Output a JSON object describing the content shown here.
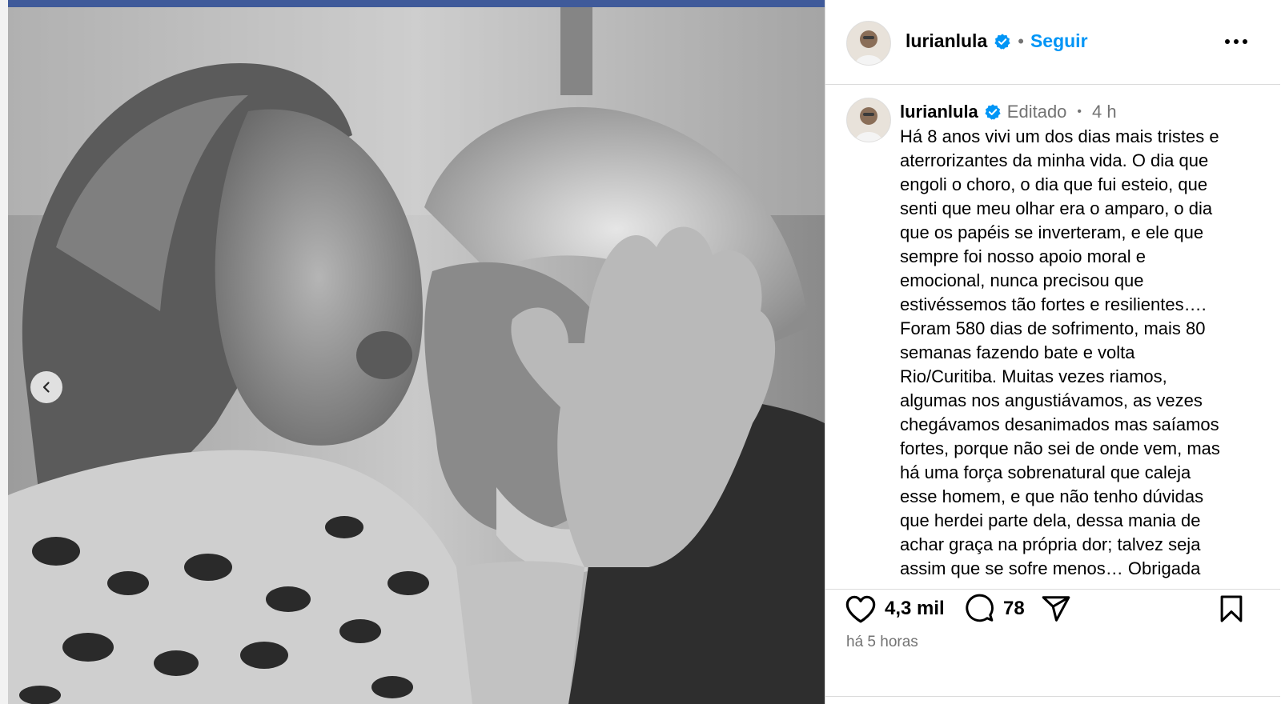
{
  "post": {
    "username": "lurianlula",
    "follow_label": "Seguir",
    "separator": "•",
    "edited_label": "Editado",
    "time_ago": "4 h",
    "caption": "Há 8 anos vivi um dos dias mais tristes e\naterrorizantes da minha vida. O dia que\nengoli o choro, o dia que fui esteio, que\nsenti que meu olhar era o amparo, o dia\nque os papéis se inverteram, e ele que\nsempre foi nosso apoio moral e\nemocional, nunca precisou que\nestivéssemos tão fortes e resilientes….\nForam 580 dias de sofrimento,  mais 80\nsemanas fazendo bate e volta\nRio/Curitiba. Muitas vezes riamos,\nalgumas nos angustiávamos, as vezes\nchegávamos desanimados mas saíamos\nfortes, porque não sei de onde vem, mas\nhá uma força sobrenatural que caleja\nesse homem, e que não tenho dúvidas\nque herdei parte dela, dessa mania de\nachar graça na própria dor; talvez seja\nassim que se sofre menos… Obrigada",
    "likes": "4,3 mil",
    "comments": "78",
    "posted_ago": "há 5 horas"
  },
  "icons": {
    "prev": "chevron-left-icon",
    "more": "more-horizontal-icon",
    "verified": "verified-badge-icon",
    "like": "heart-icon",
    "comment": "comment-icon",
    "share": "send-icon",
    "save": "bookmark-icon"
  },
  "colors": {
    "accent": "#0095f6",
    "muted": "#737373",
    "divider": "#dbdbdb",
    "media_topbar": "#3f5a9a"
  }
}
